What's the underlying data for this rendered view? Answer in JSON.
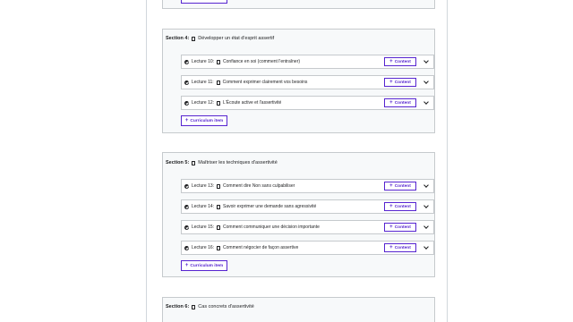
{
  "top_button": {
    "label": ""
  },
  "sections": [
    {
      "number": "Section 4:",
      "title": "Développer un état d'esprit assertif",
      "lectures": [
        {
          "number": "Lecture 10:",
          "title": "Confiance en soi (comment l'entraîner)",
          "button": "Content"
        },
        {
          "number": "Lecture 11:",
          "title": "Comment exprimer clairement vos besoins",
          "button": "Content"
        },
        {
          "number": "Lecture 12:",
          "title": "L'Écoute active et l'assertivité",
          "button": "Content"
        }
      ],
      "add_button": "Curriculum item"
    },
    {
      "number": "Section 5:",
      "title": "Maîtriser les techniques d'assertivité",
      "lectures": [
        {
          "number": "Lecture 13:",
          "title": "Comment dire Non sans culpabiliser",
          "button": "Content"
        },
        {
          "number": "Lecture 14:",
          "title": "Savoir exprimer une demande sans agressivité",
          "button": "Content"
        },
        {
          "number": "Lecture 15:",
          "title": "Comment communiquer une décision importante",
          "button": "Content"
        },
        {
          "number": "Lecture 16:",
          "title": "Comment négocier de façon assertive",
          "button": "Content"
        }
      ],
      "add_button": "Curriculum item"
    },
    {
      "number": "Section 6:",
      "title": "Cas concrets d'assertivité",
      "lectures": [],
      "add_button": ""
    }
  ],
  "colors": {
    "accent": "#5624d0",
    "section_bg": "#f7f9fa",
    "border": "#c6cacd"
  },
  "icons": {
    "completed": "check-circle-icon",
    "lecture": "document-icon",
    "expand": "chevron-down-icon",
    "add": "plus-icon"
  }
}
